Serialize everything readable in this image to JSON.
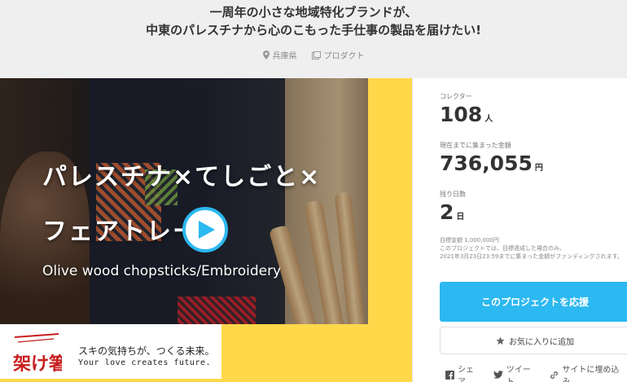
{
  "title": {
    "line1": "一周年の小さな地域特化ブランドが、",
    "line2": "中東のパレスチナから心のこもった手仕事の製品を届けたい!"
  },
  "meta": {
    "location": "兵庫県",
    "category": "プロダクト"
  },
  "hero": {
    "headline1": "パレスチナ×てしごと×",
    "headline2": "フェアトレー",
    "subline": "Olive wood chopsticks/Embroidery",
    "brand_logo_text": "架け箸",
    "brand_slogan": "スキの気持ちが、つくる未来。",
    "brand_tagline": "Your love creates future."
  },
  "stats": {
    "collectors_label": "コレクター",
    "collectors_value": "108",
    "collectors_unit": "人",
    "raised_label": "現在までに集まった金額",
    "raised_value": "736,055",
    "raised_unit": "円",
    "days_label": "残り日数",
    "days_value": "2",
    "days_unit": "日"
  },
  "goal": {
    "line1": "目標金額 1,000,000円",
    "line2": "このプロジェクトでは、目標達成した場合のみ、",
    "line3": "2021年3月23日23:59までに集まった金額がファンディングされます。"
  },
  "actions": {
    "support_label": "このプロジェクトを応援",
    "favorite_label": "お気に入りに追加"
  },
  "share": {
    "facebook_label": "シェア",
    "twitter_label": "ツイート",
    "embed_label": "サイトに埋め込み"
  },
  "colors": {
    "accent": "#2cb8f0",
    "hero_bg": "#ffd84a",
    "logo_red": "#c81e1e"
  }
}
